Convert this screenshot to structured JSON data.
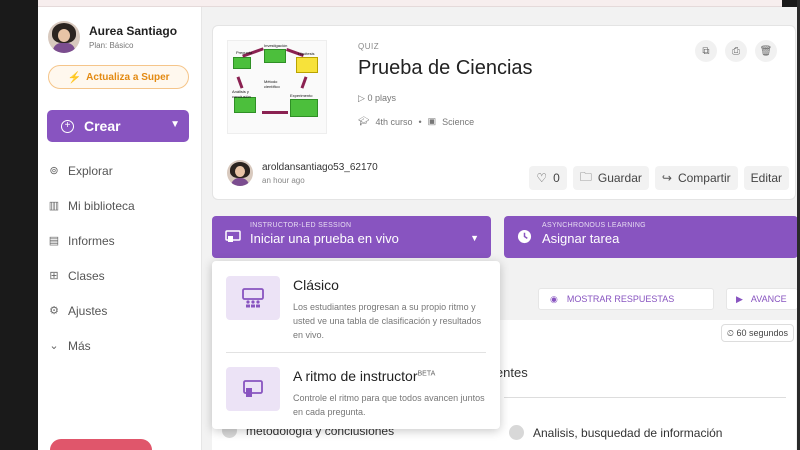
{
  "user": {
    "name": "Aurea Santiago",
    "plan": "Plan: Básico"
  },
  "upgrade_label": "Actualiza a Super",
  "create_label": "Crear",
  "nav": [
    {
      "label": "Explorar",
      "icon": "binoculars-icon"
    },
    {
      "label": "Mi biblioteca",
      "icon": "library-icon"
    },
    {
      "label": "Informes",
      "icon": "bar-chart-icon"
    },
    {
      "label": "Clases",
      "icon": "classroom-icon"
    },
    {
      "label": "Ajustes",
      "icon": "gear-icon"
    },
    {
      "label": "Más",
      "icon": "chevron-down-icon"
    }
  ],
  "quiz": {
    "type_label": "QUIZ",
    "title": "Prueba de Ciencias",
    "plays": "0 plays",
    "grade": "4th curso",
    "subject": "Science",
    "thumbnail_labels": [
      "Pregunta",
      "Investigación",
      "Hipótesis",
      "Análisis y conclusión",
      "Experimento",
      "Método científico"
    ]
  },
  "author": {
    "name": "aroldansantiago53_62170",
    "time": "an hour ago"
  },
  "actions": {
    "likes": "0",
    "save": "Guardar",
    "share": "Compartir",
    "edit": "Editar"
  },
  "session": {
    "live_sub": "INSTRUCTOR-LED SESSION",
    "live_main": "Iniciar una prueba en vivo",
    "async_sub": "ASYNCHRONOUS LEARNING",
    "async_main": "Asignar tarea"
  },
  "controls": {
    "show_answers": "MOSTRAR RESPUESTAS",
    "advance": "AVANCE"
  },
  "question": {
    "timer": "60 segundos",
    "text_fragment": "ientes",
    "option_left": "metodología y conclusiones",
    "option_right": "Analisis, busquedad de información"
  },
  "dropdown": {
    "classic_title": "Clásico",
    "classic_desc": "Los estudiantes progresan a su propio ritmo y usted ve una tabla de clasificación y resultados en vivo.",
    "paced_title": "A ritmo de instructor",
    "paced_badge": "BETA",
    "paced_desc": "Controle el ritmo para que todos avancen juntos en cada pregunta."
  },
  "colors": {
    "accent": "#8854c0",
    "upgrade": "#e38a12",
    "logout": "#e0566b"
  }
}
